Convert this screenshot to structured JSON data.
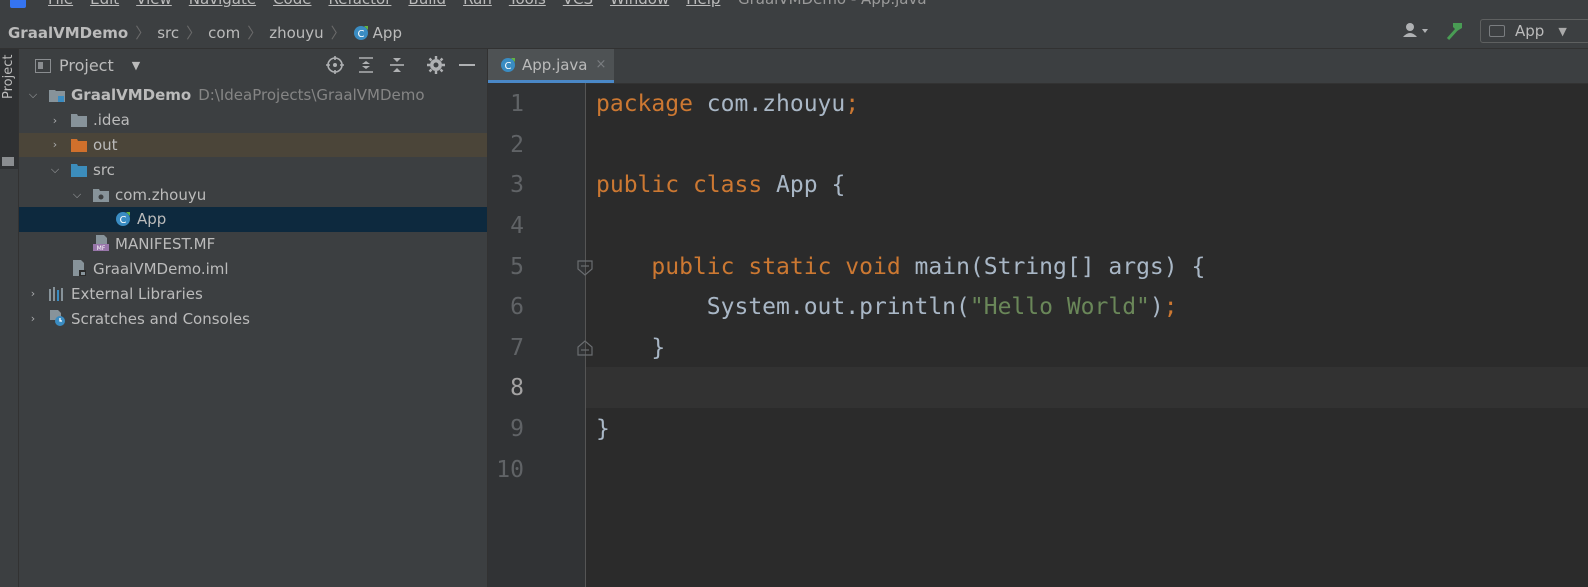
{
  "menubar": {
    "items": [
      "File",
      "Edit",
      "View",
      "Navigate",
      "Code",
      "Refactor",
      "Build",
      "Run",
      "Tools",
      "VCS",
      "Window",
      "Help"
    ],
    "window_title": "GraalVMDemo - App.java"
  },
  "breadcrumb": {
    "project": "GraalVMDemo",
    "src": "src",
    "com": "com",
    "zhouyu": "zhouyu",
    "app": "App"
  },
  "toolbar": {
    "run_config": "App",
    "icons": [
      "user-icon",
      "hammer-icon",
      "run-config-icon"
    ]
  },
  "tool_stripe": {
    "project_label": "Project"
  },
  "project_panel": {
    "title": "Project",
    "tool_icons": [
      "locate-icon",
      "expand-all-icon",
      "collapse-all-icon",
      "gear-icon",
      "minimize-icon"
    ],
    "tree": [
      {
        "label": "GraalVMDemo",
        "hint": "D:\\IdeaProjects\\GraalVMDemo",
        "depth": 0,
        "expanded": true,
        "icon": "module-folder-icon"
      },
      {
        "label": ".idea",
        "depth": 1,
        "expanded": false,
        "icon": "folder-icon"
      },
      {
        "label": "out",
        "depth": 1,
        "expanded": false,
        "icon": "excluded-folder-icon"
      },
      {
        "label": "src",
        "depth": 1,
        "expanded": true,
        "icon": "source-folder-icon"
      },
      {
        "label": "com.zhouyu",
        "depth": 2,
        "expanded": true,
        "icon": "package-icon"
      },
      {
        "label": "App",
        "depth": 3,
        "icon": "java-class-icon",
        "selected": true
      },
      {
        "label": "MANIFEST.MF",
        "depth": 2,
        "icon": "manifest-icon"
      },
      {
        "label": "GraalVMDemo.iml",
        "depth": 1,
        "icon": "iml-file-icon"
      },
      {
        "label": "External Libraries",
        "depth": 0,
        "expanded": false,
        "icon": "libraries-icon"
      },
      {
        "label": "Scratches and Consoles",
        "depth": 0,
        "expanded": false,
        "icon": "scratches-icon"
      }
    ]
  },
  "editor": {
    "tab": {
      "label": "App.java",
      "close": "×"
    },
    "line_numbers": [
      "1",
      "2",
      "3",
      "4",
      "5",
      "6",
      "7",
      "8",
      "9",
      "10"
    ],
    "current_line": 8,
    "code": {
      "l1_kw": "package",
      "l1_rest": " com.zhouyu",
      "l1_semi": ";",
      "l3_kw1": "public",
      "l3_kw2": "class",
      "l3_rest": " App {",
      "l5_kw1": "public",
      "l5_kw2": "static",
      "l5_kw3": "void",
      "l5_rest": " main(String[] args) {",
      "l6_a": "System.out.println(",
      "l6_str": "\"Hello World\"",
      "l6_b": ")",
      "l6_semi": ";",
      "l7": "}",
      "l9": "}"
    }
  },
  "colors": {
    "keyword": "#cc7832",
    "string": "#6a8759",
    "identifier": "#a9b7c6",
    "selection": "#0d293e",
    "excluded": "#4b4539"
  }
}
